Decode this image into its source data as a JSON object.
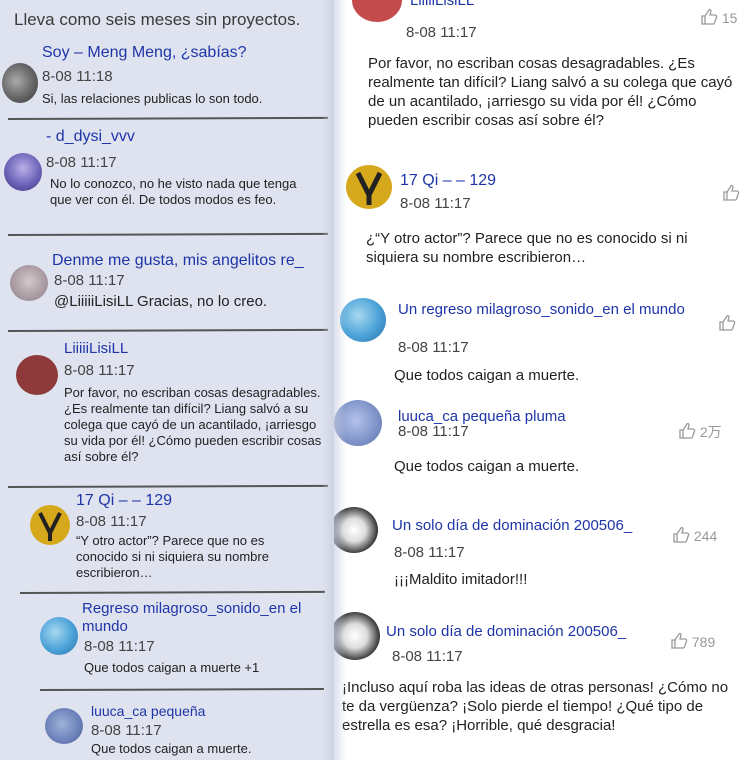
{
  "left": {
    "header": "Lleva como seis meses sin proyectos.",
    "comments": [
      {
        "name": "Soy – Meng Meng, ¿sabías?",
        "time": "8-08 11:18",
        "text": "Si, las relaciones publicas lo son todo."
      },
      {
        "name": "- d_dysi_vvv",
        "time": "8-08 11:17",
        "text": "No lo conozco, no he visto nada que tenga que ver con él. De todos modos es feo."
      },
      {
        "name": "Denme me gusta, mis angelitos re_",
        "time": "8-08 11:17",
        "text": "@LiiiiiLisiLL Gracias, no lo creo."
      },
      {
        "name": "LiiiiiLisiLL",
        "time": "8-08 11:17",
        "text": "Por favor, no escriban cosas desagradables. ¿Es realmente tan difícil? Liang salvó a su colega que cayó de un acantilado, ¡arriesgo su vida por él! ¿Cómo pueden escribir cosas así sobre él?"
      },
      {
        "name": "17 Qi – – 129",
        "time": "8-08 11:17",
        "text": "“Y otro actor”? Parece que no es conocido si ni siquiera su nombre escribieron…"
      },
      {
        "name": "Regreso milagroso_sonido_en el mundo",
        "time": "8-08 11:17",
        "text": "Que todos caigan a muerte +1"
      },
      {
        "name": "luuca_ca pequeña",
        "time": "8-08 11:17",
        "text": "Que todos caigan a muerte."
      }
    ]
  },
  "right": {
    "comments": [
      {
        "name": "LiiiiiLisiLL",
        "time": "8-08 11:17",
        "likes": "15",
        "text": "Por favor, no escriban cosas desagradables. ¿Es realmente tan difícil? Liang salvó a su colega que cayó de un acantilado, ¡arriesgo su vida por él! ¿Cómo pueden escribir cosas así sobre él?"
      },
      {
        "name": "17 Qi – – 129",
        "time": "8-08 11:17",
        "likes": "",
        "text": "¿“Y otro actor”? Parece que no es conocido si ni siquiera su nombre escribieron…"
      },
      {
        "name": "Un regreso milagroso_sonido_en el mundo",
        "time": "8-08 11:17",
        "likes": "",
        "text": "Que todos caigan a muerte."
      },
      {
        "name": "luuca_ca pequeña pluma",
        "time": "8-08 11:17",
        "likes": "2万",
        "text": "Que todos caigan a muerte."
      },
      {
        "name": "Un solo día de dominación 200506_",
        "time": "8-08 11:17",
        "likes": "244",
        "text": "¡¡¡Maldito imitador!!!"
      },
      {
        "name": "Un solo día de dominación 200506_",
        "time": "8-08 11:17",
        "likes": "789",
        "text": "¡Incluso aquí roba las ideas de otras personas! ¿Cómo no te da vergüenza? ¡Solo pierde el tiempo! ¿Qué tipo de estrella es esa? ¡Horrible, qué desgracia!"
      }
    ]
  },
  "colors": {
    "name_blue": "#1e35a8",
    "left_bg": "#dfe3ef"
  },
  "icons": [
    "thumbs-up-icon",
    "avatar-image"
  ]
}
